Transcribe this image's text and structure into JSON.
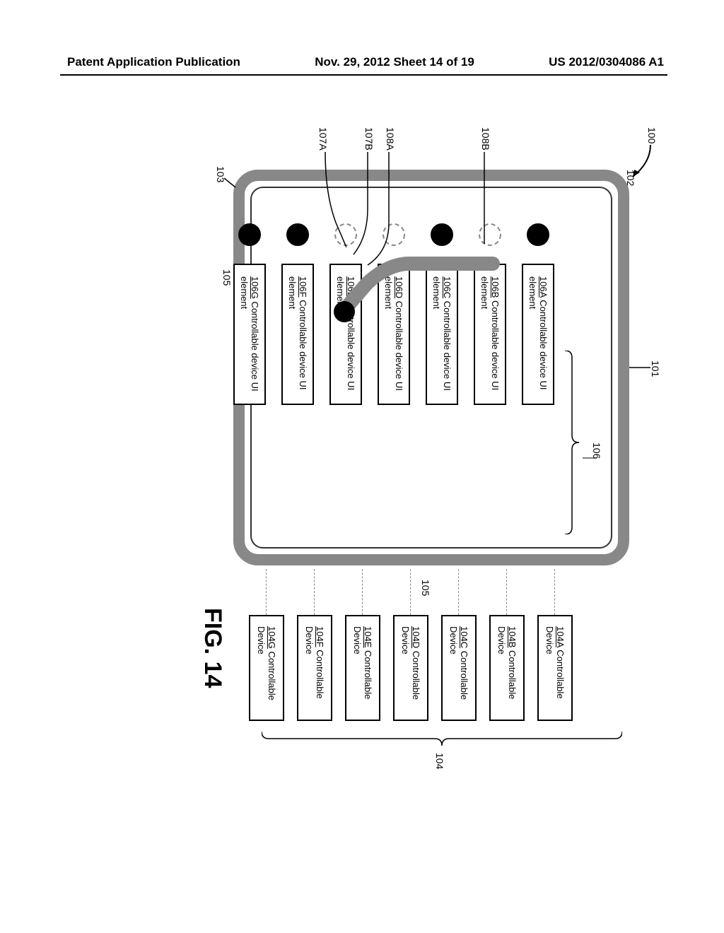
{
  "header": {
    "left": "Patent Application Publication",
    "center": "Nov. 29, 2012  Sheet 14 of 19",
    "right": "US 2012/0304086 A1"
  },
  "figure": {
    "label": "FIG. 14",
    "system_ref": "100",
    "touch_device_ref": "101",
    "display_panel_ref": "102",
    "tablet_border_ref": "103",
    "devices_group_ref": "104",
    "links_ref": "105",
    "ui_group_ref": "106",
    "ui_links_ref": "105",
    "gesture_start_ref": "107A",
    "gesture_end_ref": "107B",
    "highlight_ref_a": "108A",
    "highlight_ref_b": "108B",
    "ui_elements": [
      {
        "ref": "106A",
        "label": "Controllable device UI element"
      },
      {
        "ref": "106B",
        "label": "Controllable device UI element"
      },
      {
        "ref": "106C",
        "label": "Controllable device UI element"
      },
      {
        "ref": "106D",
        "label": "Controllable device UI element"
      },
      {
        "ref": "106E",
        "label": "Controllable device UI element"
      },
      {
        "ref": "106F",
        "label": "Controllable device UI element"
      },
      {
        "ref": "106G",
        "label": "Controllable device UI element"
      }
    ],
    "devices": [
      {
        "ref": "104A",
        "label": "Controllable Device"
      },
      {
        "ref": "104B",
        "label": "Controllable Device"
      },
      {
        "ref": "104C",
        "label": "Controllable Device"
      },
      {
        "ref": "104D",
        "label": "Controllable Device"
      },
      {
        "ref": "104E",
        "label": "Controllable Device"
      },
      {
        "ref": "104F",
        "label": "Controllable Device"
      },
      {
        "ref": "104G",
        "label": "Controllable Device"
      }
    ]
  }
}
